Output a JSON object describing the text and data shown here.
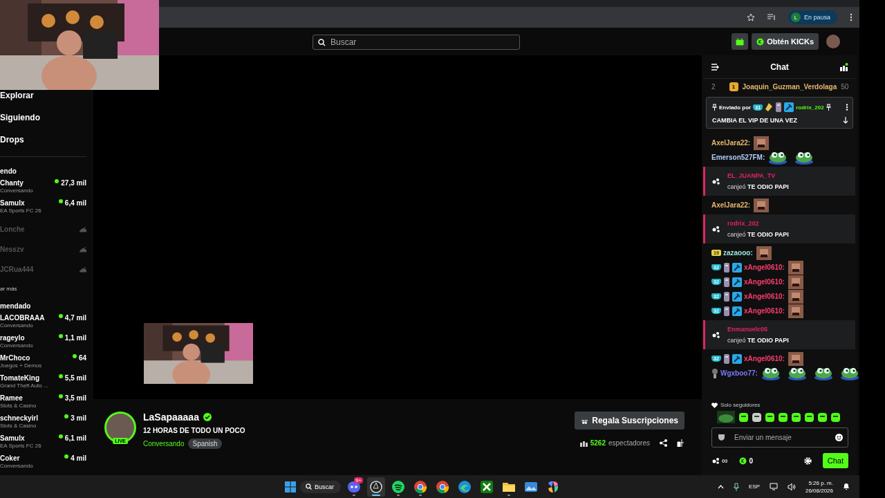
{
  "browser": {
    "profile": {
      "initial": "L",
      "status": "En pausa"
    }
  },
  "header": {
    "search": {
      "placeholder": "Buscar"
    },
    "kicks_button": "Obtén KICKs"
  },
  "sidebar": {
    "nav": [
      {
        "label": "Explorar"
      },
      {
        "label": "Siguiendo"
      },
      {
        "label": "Drops"
      }
    ],
    "sections": [
      {
        "heading": "endo",
        "more": "ar más",
        "channels": [
          {
            "name": "Chanty",
            "category": "Conversando",
            "viewers": "27,3 mil",
            "live": true
          },
          {
            "name": "Samulx",
            "category": "EA Sports FC 26",
            "viewers": "6,4 mil",
            "live": true
          },
          {
            "name": "Lonche",
            "live": false
          },
          {
            "name": "Nesszv",
            "live": false
          },
          {
            "name": "JCRua444",
            "live": false
          }
        ]
      },
      {
        "heading": "mendado",
        "channels": [
          {
            "name": "LACOBRAAA",
            "category": "Conversando",
            "viewers": "4,7 mil",
            "live": true
          },
          {
            "name": "rageylo",
            "category": "Conversando",
            "viewers": "1,1 mil",
            "live": true
          },
          {
            "name": "MrChoco",
            "category": "Juegos + Demos",
            "viewers": "64",
            "live": true
          },
          {
            "name": "TomateKing",
            "category": "Grand Theft Auto ...",
            "viewers": "5,5 mil",
            "live": true
          },
          {
            "name": "Ramee",
            "category": "Slots & Casino",
            "viewers": "3,5 mil",
            "live": true
          },
          {
            "name": "schneckyirl",
            "category": "Slots & Casino",
            "viewers": "3 mil",
            "live": true
          },
          {
            "name": "Samulx",
            "category": "EA Sports FC 26",
            "viewers": "6,1 mil",
            "live": true
          },
          {
            "name": "Coker",
            "category": "Conversando",
            "viewers": "4 mil",
            "live": true
          }
        ]
      }
    ]
  },
  "stream": {
    "name": "LaSapaaaaa",
    "verified": true,
    "live_badge": "LIVE",
    "title": "12 HORAS DE TODO UN POCO",
    "category": "Conversando",
    "tags": [
      "Spanish"
    ],
    "gift_button": "Regala Suscripciones",
    "viewers": "5262",
    "viewers_label": "espectadores"
  },
  "chat": {
    "title": "Chat",
    "leaderboard": {
      "rank": "2",
      "badge": "1",
      "user": "Joaquin_Guzman_Verdolaga",
      "score": "50"
    },
    "pinned": {
      "label": "Enviado por",
      "badges": [
        {
          "kind": "sub",
          "label": "31"
        },
        {
          "kind": "gift"
        },
        {
          "kind": "gem"
        },
        {
          "kind": "mod"
        }
      ],
      "user": "rodrix_202",
      "text": "CAMBIA EL VIP DE UNA VEZ"
    },
    "messages": [
      {
        "kind": "chat",
        "user": "AxelJara22:",
        "color": "#e8b86a",
        "emotes": [
          {
            "kind": "face"
          }
        ]
      },
      {
        "kind": "chat",
        "user": "Emerson527FM:",
        "color": "#b0cdf5",
        "emotes": [
          {
            "kind": "frog"
          },
          {
            "kind": "frog"
          }
        ]
      },
      {
        "kind": "redeem",
        "user": "EL_JUANPA_TV",
        "color": "#e0245e",
        "text": "canjeó **TE ODIO PAPI**"
      },
      {
        "kind": "chat",
        "user": "AxelJara22:",
        "color": "#e8b86a",
        "emotes": [
          {
            "kind": "face"
          }
        ]
      },
      {
        "kind": "redeem",
        "user": "rodrix_202",
        "color": "#e0245e",
        "text": "canjeó **TE ODIO PAPI**"
      },
      {
        "kind": "chat",
        "user": "zazaooo:",
        "color": "#9fe7e0",
        "badges": [
          {
            "kind": "sub19",
            "label": "19"
          }
        ],
        "emotes": [
          {
            "kind": "face"
          }
        ]
      },
      {
        "kind": "chat",
        "user": "xAngel0610:",
        "color": "#ff3d6e",
        "badges": [
          {
            "kind": "sub",
            "label": "32"
          },
          {
            "kind": "gem"
          },
          {
            "kind": "mod"
          }
        ],
        "emotes": [
          {
            "kind": "face"
          }
        ]
      },
      {
        "kind": "chat",
        "user": "xAngel0610:",
        "color": "#ff3d6e",
        "badges": [
          {
            "kind": "sub",
            "label": "32"
          },
          {
            "kind": "gem"
          },
          {
            "kind": "mod"
          }
        ],
        "emotes": [
          {
            "kind": "face"
          }
        ]
      },
      {
        "kind": "chat",
        "user": "xAngel0610:",
        "color": "#ff3d6e",
        "badges": [
          {
            "kind": "sub",
            "label": "32"
          },
          {
            "kind": "gem"
          },
          {
            "kind": "mod"
          }
        ],
        "emotes": [
          {
            "kind": "face"
          }
        ]
      },
      {
        "kind": "chat",
        "user": "xAngel0610:",
        "color": "#ff3d6e",
        "badges": [
          {
            "kind": "sub",
            "label": "32"
          },
          {
            "kind": "gem"
          },
          {
            "kind": "mod"
          }
        ],
        "emotes": [
          {
            "kind": "face"
          }
        ]
      },
      {
        "kind": "redeem",
        "user": "Enmanuelc05",
        "color": "#e0245e",
        "text": "canjeó **TE ODIO PAPI**"
      },
      {
        "kind": "chat",
        "user": "xAngel0610:",
        "color": "#ff3d6e",
        "badges": [
          {
            "kind": "sub",
            "label": "32"
          },
          {
            "kind": "gem"
          },
          {
            "kind": "mod"
          }
        ],
        "emotes": [
          {
            "kind": "face"
          }
        ]
      },
      {
        "kind": "chat",
        "user": "Wgxboo77:",
        "color": "#7b7bff",
        "badges": [
          {
            "kind": "bulb"
          }
        ],
        "emotes": [
          {
            "kind": "frog"
          },
          {
            "kind": "frog"
          },
          {
            "kind": "frog"
          },
          {
            "kind": "frog"
          }
        ]
      }
    ],
    "mode": "Solo seguidores",
    "input": {
      "placeholder": "Enviar un mensaje"
    },
    "points": "∞",
    "kicks": "0",
    "send_button": "Chat"
  },
  "taskbar": {
    "search": "Buscar",
    "apps": [
      {
        "kind": "discord",
        "badge": "9+",
        "running": true,
        "selected": false
      },
      {
        "kind": "obs",
        "running": true,
        "selected": true
      },
      {
        "kind": "spotify",
        "running": true,
        "selected": false
      },
      {
        "kind": "chrome",
        "running": true,
        "selected": false
      },
      {
        "kind": "chrome",
        "running": false,
        "selected": false
      },
      {
        "kind": "edge",
        "running": false,
        "selected": false
      },
      {
        "kind": "xbox",
        "running": false,
        "selected": false
      },
      {
        "kind": "folder",
        "running": true,
        "selected": false
      },
      {
        "kind": "photos",
        "running": false,
        "selected": false
      },
      {
        "kind": "copilot",
        "running": false,
        "selected": false
      }
    ],
    "lang": "ESP",
    "time": "5:26 p. m.",
    "date": "26/08/2026"
  }
}
